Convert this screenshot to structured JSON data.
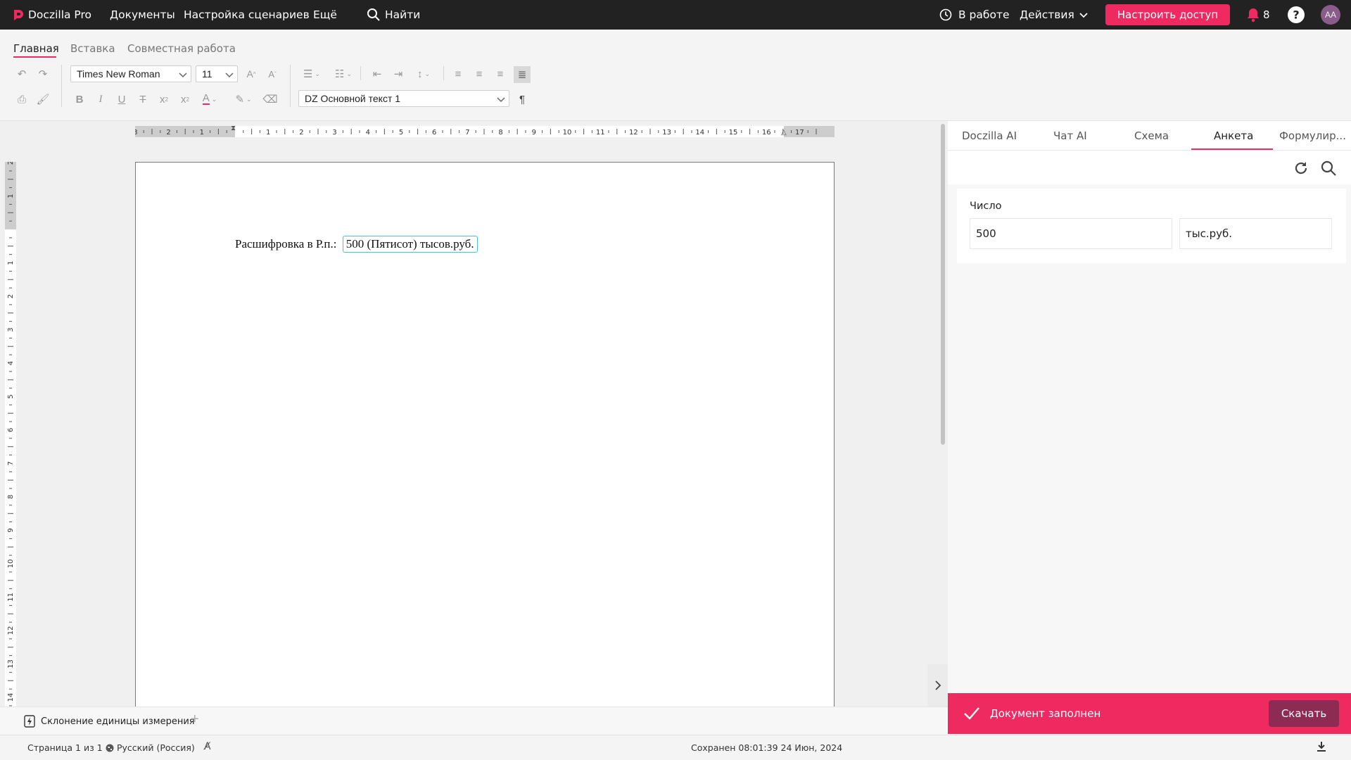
{
  "topbar": {
    "app_name": "Doczilla Pro",
    "nav": [
      "Документы",
      "Настройка сценариев",
      "Ещё"
    ],
    "search_label": "Найти",
    "status_label": "В работе",
    "actions_label": "Действия",
    "access_button": "Настроить доступ",
    "notifications_count": "8",
    "avatar_initials": "AA"
  },
  "toolbar": {
    "tabs": [
      "Главная",
      "Вставка",
      "Совместная работа"
    ],
    "font_family": "Times New Roman",
    "font_size": "11",
    "paragraph_style": "DZ Основной текст 1"
  },
  "ruler": {
    "horizontal": [
      "3",
      "2",
      "1",
      "1",
      "2",
      "3",
      "4",
      "5",
      "6",
      "7",
      "8",
      "9",
      "10",
      "11",
      "12",
      "13",
      "14",
      "15",
      "16",
      "17"
    ],
    "vertical": [
      "2",
      "1",
      "1",
      "2",
      "3",
      "4",
      "5",
      "6",
      "7",
      "8",
      "9",
      "10",
      "11",
      "12",
      "13",
      "14"
    ]
  },
  "document": {
    "label": "Расшифровка в Р.п.:",
    "field_value": "500 (Пятисот) тысов.руб."
  },
  "side_panel": {
    "tabs": [
      "Doczilla AI",
      "Чат AI",
      "Схема",
      "Анкета",
      "Формулир..."
    ],
    "active_tab": "Анкета",
    "field_label": "Число",
    "number_value": "500",
    "unit_value": "тыс.руб.",
    "done_message": "Документ заполнен",
    "download_button": "Скачать"
  },
  "bottom": {
    "scenario_tab": "Склонение единицы измерения"
  },
  "status": {
    "page_info": "Страница 1 из 1",
    "language": "Русский (Россия)",
    "saved": "Сохранен 08:01:39 24 Июн, 2024"
  },
  "colors": {
    "accent": "#ef2a61",
    "topbar_bg": "#222222",
    "field_border": "#45c7d1",
    "download_bg": "#8e2b52"
  }
}
